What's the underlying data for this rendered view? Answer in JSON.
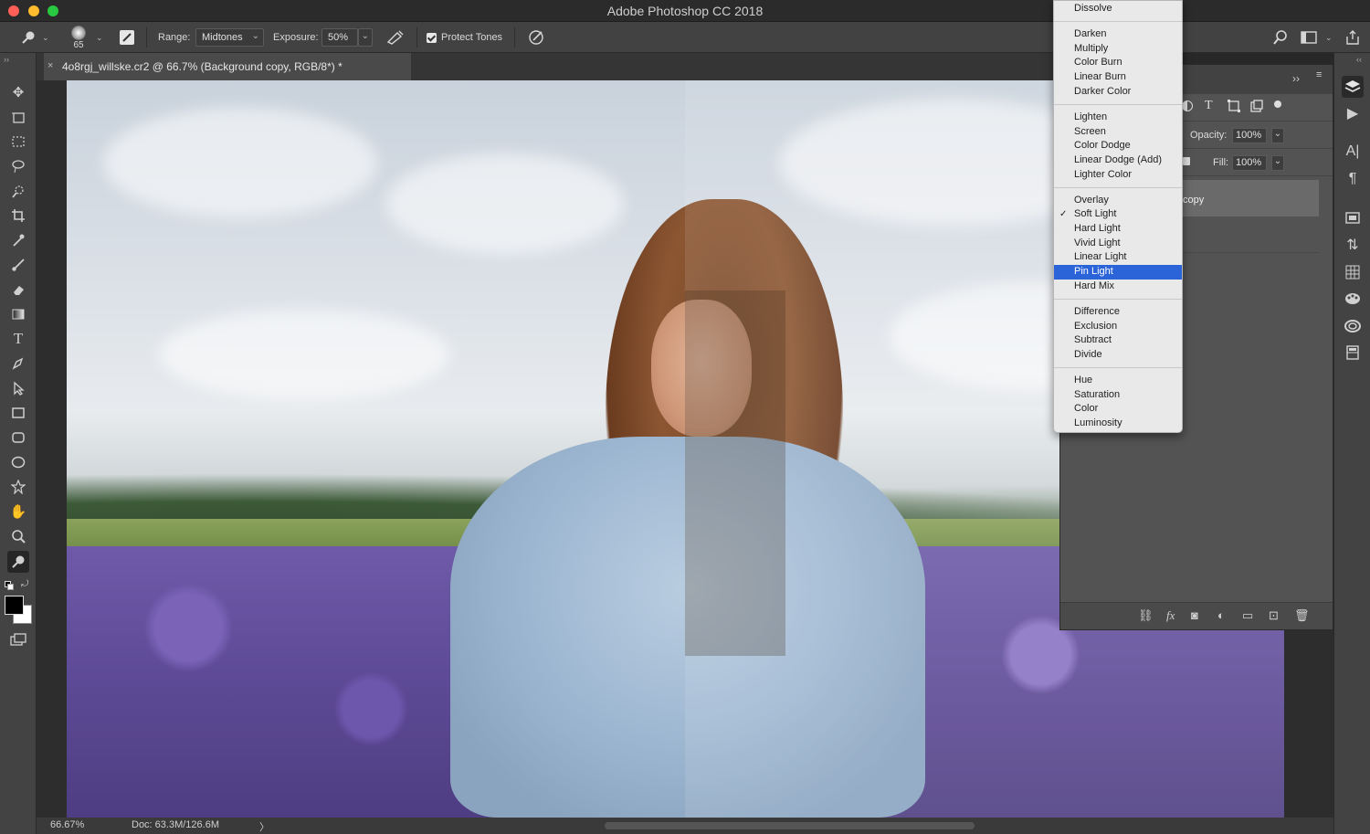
{
  "app": {
    "title": "Adobe Photoshop CC 2018"
  },
  "options_bar": {
    "brush_size": "65",
    "range_label": "Range:",
    "range_value": "Midtones",
    "exposure_label": "Exposure:",
    "exposure_value": "50%",
    "protect_tones_label": "Protect Tones",
    "protect_tones_checked": true
  },
  "document": {
    "tab_title": "4o8rgj_willske.cr2 @ 66.7% (Background copy, RGB/8*) *",
    "close_glyph": "×"
  },
  "status_bar": {
    "zoom": "66.67%",
    "doc_info": "Doc: 63.3M/126.6M",
    "arrow": "〉"
  },
  "layers_panel": {
    "opacity_label": "Opacity:",
    "opacity_value": "100%",
    "fill_label": "Fill:",
    "fill_value": "100%",
    "layer_name_partial": "copy"
  },
  "blend_menu": {
    "groups": [
      [
        "Dissolve"
      ],
      [
        "Darken",
        "Multiply",
        "Color Burn",
        "Linear Burn",
        "Darker Color"
      ],
      [
        "Lighten",
        "Screen",
        "Color Dodge",
        "Linear Dodge (Add)",
        "Lighter Color"
      ],
      [
        "Overlay",
        "Soft Light",
        "Hard Light",
        "Vivid Light",
        "Linear Light",
        "Pin Light",
        "Hard Mix"
      ],
      [
        "Difference",
        "Exclusion",
        "Subtract",
        "Divide"
      ],
      [
        "Hue",
        "Saturation",
        "Color",
        "Luminosity"
      ]
    ],
    "checked": "Soft Light",
    "highlighted": "Pin Light"
  },
  "colors": {
    "highlight": "#2b63d9",
    "panel_bg": "#535353",
    "toolbar_bg": "#434343"
  },
  "tools": [
    "move-icon",
    "artboard-icon",
    "marquee-icon",
    "lasso-icon",
    "quick-select-icon",
    "crop-icon",
    "eyedropper-icon",
    "brush-icon",
    "eraser-icon",
    "gradient-icon",
    "type-icon",
    "pen-icon",
    "path-select-icon",
    "rectangle-icon",
    "rounded-rect-icon",
    "ellipse-icon",
    "custom-shape-icon",
    "hand-icon",
    "zoom-icon",
    "dodge-icon"
  ]
}
